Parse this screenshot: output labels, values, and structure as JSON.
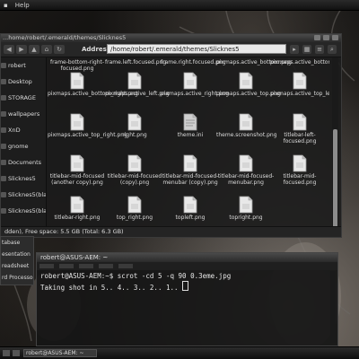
{
  "menubar": {
    "items": [
      "Help"
    ]
  },
  "file_manager": {
    "title": "...home/robert/.emerald/themes/Slicknes5",
    "address_label": "Address:",
    "address_value": "/home/robert/.emerald/themes/Slicknes5",
    "sidebar": [
      "robert",
      "Desktop",
      "STORAGE",
      "wallpapers",
      "XnD",
      "gnome",
      "Documents",
      "Slicknes5",
      "Slicknes5(black...",
      "Slicknes5(black-m..."
    ],
    "files": [
      "frame-bottom-right-focused.png",
      "frame.left.focused.png",
      "frame.right.focused.png",
      "pixmaps.active_bottom.png",
      "pixmaps.active_bottom_left.png",
      "pixmaps.active_bottom_right.png",
      "pixmaps.active_left.png",
      "pixmaps.active_right.png",
      "pixmaps.active_top.png",
      "pixmaps.active_top_left.png",
      "pixmaps.active_top_right.png",
      "right.png",
      "theme.ini",
      "theme.screenshot.png",
      "titlebar-left-focused.png",
      "titlebar-mid-focused (another copy).png",
      "titlebar-mid-focused (copy).png",
      "titlebar-mid-focused-menubar (copy).png",
      "titlebar-mid-focused-menubar.png",
      "titlebar-mid-focused.png",
      "titlebar-right.png",
      "top_right.png",
      "topleft.png",
      "topright.png"
    ],
    "partial_top_labels": [
      "frame-bottom-right-focused.png",
      "frame.left.focused.png",
      "frame.right.focused.png",
      "pixmaps.active_bottom.png",
      "pixmaps.active_bottom_left.png"
    ],
    "status": "dden), Free space: 5.5 GB (Total: 6.3 GB)"
  },
  "app_menu": [
    "tabase",
    "esentation",
    "readsheet",
    "rd Processor"
  ],
  "terminal": {
    "title": "robert@ASUS-AEM: ~",
    "lines": [
      "robert@ASUS-AEM:~$ scrot -cd 5 -q 90 0.3eme.jpg",
      "Taking shot in 5.. 4.. 3.. 2.. 1.. "
    ]
  },
  "taskbar": {
    "items": [
      "robert@ASUS-AEM: ~"
    ]
  }
}
